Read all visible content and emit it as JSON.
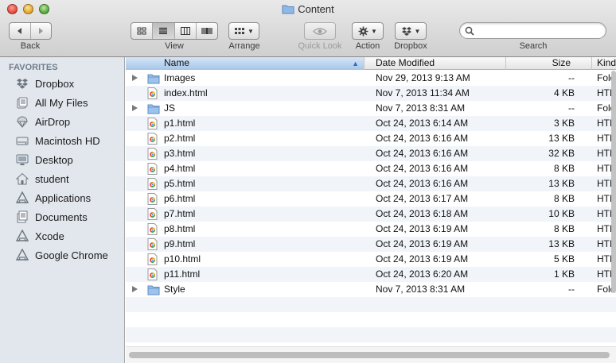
{
  "window": {
    "title": "Content"
  },
  "toolbar": {
    "back_label": "Back",
    "view_label": "View",
    "arrange_label": "Arrange",
    "quicklook_label": "Quick Look",
    "action_label": "Action",
    "dropbox_label": "Dropbox",
    "search_label": "Search",
    "search_value": ""
  },
  "sidebar": {
    "heading": "FAVORITES",
    "items": [
      {
        "label": "Dropbox",
        "icon": "dropbox-icon"
      },
      {
        "label": "All My Files",
        "icon": "all-files-icon"
      },
      {
        "label": "AirDrop",
        "icon": "airdrop-icon"
      },
      {
        "label": "Macintosh HD",
        "icon": "hard-drive-icon"
      },
      {
        "label": "Desktop",
        "icon": "desktop-icon"
      },
      {
        "label": "student",
        "icon": "home-icon"
      },
      {
        "label": "Applications",
        "icon": "applications-icon"
      },
      {
        "label": "Documents",
        "icon": "documents-icon"
      },
      {
        "label": "Xcode",
        "icon": "applications-icon"
      },
      {
        "label": "Google Chrome",
        "icon": "applications-icon"
      }
    ]
  },
  "columns": {
    "name": "Name",
    "date": "Date Modified",
    "size": "Size",
    "kind": "Kind"
  },
  "files": [
    {
      "name": "Images",
      "date": "Nov 29, 2013 9:13 AM",
      "size": "--",
      "kind": "Folder",
      "type": "folder"
    },
    {
      "name": "index.html",
      "date": "Nov 7, 2013 11:34 AM",
      "size": "4 KB",
      "kind": "HTML",
      "type": "html"
    },
    {
      "name": "JS",
      "date": "Nov 7, 2013 8:31 AM",
      "size": "--",
      "kind": "Folder",
      "type": "folder"
    },
    {
      "name": "p1.html",
      "date": "Oct 24, 2013 6:14 AM",
      "size": "3 KB",
      "kind": "HTML",
      "type": "html"
    },
    {
      "name": "p2.html",
      "date": "Oct 24, 2013 6:16 AM",
      "size": "13 KB",
      "kind": "HTML",
      "type": "html"
    },
    {
      "name": "p3.html",
      "date": "Oct 24, 2013 6:16 AM",
      "size": "32 KB",
      "kind": "HTML",
      "type": "html"
    },
    {
      "name": "p4.html",
      "date": "Oct 24, 2013 6:16 AM",
      "size": "8 KB",
      "kind": "HTML",
      "type": "html"
    },
    {
      "name": "p5.html",
      "date": "Oct 24, 2013 6:16 AM",
      "size": "13 KB",
      "kind": "HTML",
      "type": "html"
    },
    {
      "name": "p6.html",
      "date": "Oct 24, 2013 6:17 AM",
      "size": "8 KB",
      "kind": "HTML",
      "type": "html"
    },
    {
      "name": "p7.html",
      "date": "Oct 24, 2013 6:18 AM",
      "size": "10 KB",
      "kind": "HTML",
      "type": "html"
    },
    {
      "name": "p8.html",
      "date": "Oct 24, 2013 6:19 AM",
      "size": "8 KB",
      "kind": "HTML",
      "type": "html"
    },
    {
      "name": "p9.html",
      "date": "Oct 24, 2013 6:19 AM",
      "size": "13 KB",
      "kind": "HTML",
      "type": "html"
    },
    {
      "name": "p10.html",
      "date": "Oct 24, 2013 6:19 AM",
      "size": "5 KB",
      "kind": "HTML",
      "type": "html"
    },
    {
      "name": "p11.html",
      "date": "Oct 24, 2013 6:20 AM",
      "size": "1 KB",
      "kind": "HTML",
      "type": "html"
    },
    {
      "name": "Style",
      "date": "Nov 7, 2013 8:31 AM",
      "size": "--",
      "kind": "Folder",
      "type": "folder"
    }
  ]
}
